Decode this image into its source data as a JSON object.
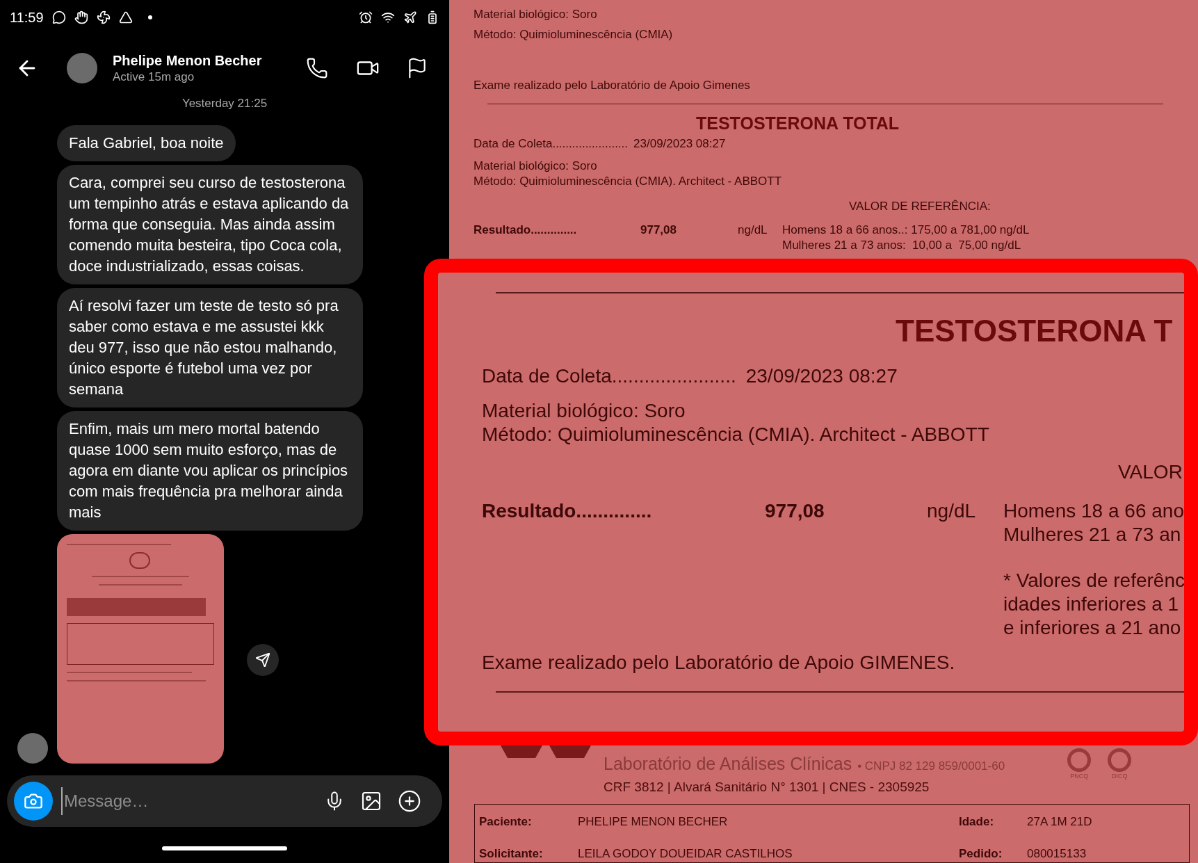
{
  "status_bar": {
    "time": "11:59"
  },
  "chat_header": {
    "name": "Phelipe Menon Becher",
    "status": "Active 15m ago"
  },
  "timestamp": "Yesterday 21:25",
  "messages": [
    {
      "kind": "text",
      "text": "Fala Gabriel, boa noite"
    },
    {
      "kind": "text",
      "text": "Cara, comprei seu curso de testosterona um tempinho atrás e estava aplicando da forma que conseguia. Mas ainda assim comendo muita besteira, tipo Coca cola, doce industrializado, essas coisas."
    },
    {
      "kind": "text",
      "text": "Aí resolvi fazer um teste de testo só pra saber como estava e me assustei kkk deu 977, isso que não estou malhando, único esporte é futebol uma vez por semana"
    },
    {
      "kind": "text",
      "text": "Enfim, mais um mero mortal batendo quase 1000 sem muito esforço, mas de agora em diante vou aplicar os princípios com mais frequência pra melhorar ainda mais"
    },
    {
      "kind": "image"
    }
  ],
  "composer": {
    "placeholder": "Message…"
  },
  "document": {
    "previous_section": {
      "lines": [
        "Material biológico: Soro",
        "Método: Quimioluminescência (CMIA)"
      ],
      "footer": "Exame realizado pelo Laboratório de Apoio Gimenes"
    },
    "section": {
      "title": "TESTOSTERONA TOTAL",
      "collection_label": "Data de Coleta.......................",
      "collection_date": "23/09/2023 08:27",
      "material": "Material biológico: Soro",
      "method": "Método: Quimioluminescência (CMIA). Architect - ABBOTT",
      "reference_heading": "VALOR DE REFERÊNCIA:",
      "result_label": "Resultado..............",
      "result_value": "977,08",
      "unit": "ng/dL",
      "references": [
        "Homens 18 a 66 anos..: 175,00 a 781,00 ng/dL",
        "Mulheres 21 a 73 anos:  10,00 a  75,00 ng/dL"
      ]
    },
    "zoomed_section": {
      "title": "TESTOSTERONA T",
      "collection_label": "Data de Coleta.......................",
      "collection_date": "23/09/2023 08:27",
      "material": "Material biológico: Soro",
      "method": "Método: Quimioluminescência (CMIA). Architect - ABBOTT",
      "reference_heading": "VALOR",
      "result_label": "Resultado..............",
      "result_value": "977,08",
      "unit": "ng/dL",
      "references": [
        "Homens 18 a 66 ano",
        "Mulheres 21 a 73 an"
      ],
      "note_lines": [
        "* Valores de referênc",
        "idades inferiores a 1",
        "e inferiores a 21 ano"
      ],
      "footer": "Exame realizado pelo Laboratório de Apoio GIMENES."
    },
    "lab_header": {
      "name": "Laboratório de Análises Clínicas",
      "cnpj": "• CNPJ 82 129 859/0001-60",
      "registry": "CRF 3812 | Alvará Sanitário N° 1301 | CNES - 2305925",
      "seals": [
        "PNCQ",
        "DICQ"
      ]
    },
    "patient_fields": [
      {
        "label": "Paciente:",
        "value": "PHELIPE MENON BECHER",
        "side_label": "Idade:",
        "side_value": "27A 1M 21D"
      },
      {
        "label": "Solicitante:",
        "value": "LEILA GODOY DOUEIDAR CASTILHOS",
        "side_label": "Pedido:",
        "side_value": "080015133"
      }
    ]
  }
}
